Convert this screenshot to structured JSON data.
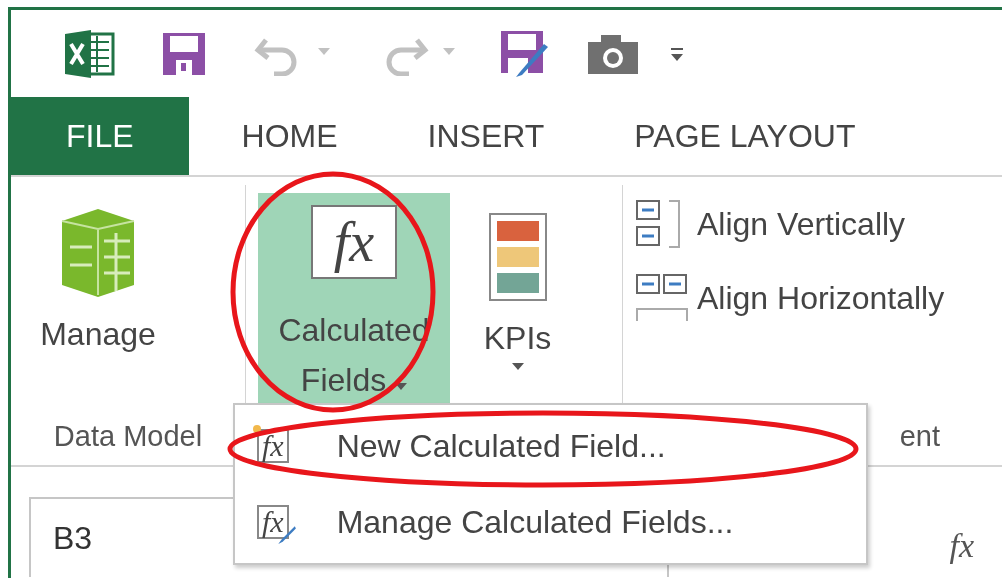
{
  "quick_access": [
    {
      "kind": "excel",
      "disabled": false
    },
    {
      "kind": "save",
      "disabled": false
    },
    {
      "kind": "undo",
      "disabled": true
    },
    {
      "kind": "redo",
      "disabled": true
    },
    {
      "kind": "save-edit",
      "disabled": false
    },
    {
      "kind": "camera",
      "disabled": false
    },
    {
      "kind": "customize",
      "disabled": false
    }
  ],
  "tabs": [
    {
      "label": "FILE",
      "kind": "file"
    },
    {
      "label": "HOME",
      "kind": "tab"
    },
    {
      "label": "INSERT",
      "kind": "tab"
    },
    {
      "label": "PAGE LAYOUT",
      "kind": "tab"
    }
  ],
  "ribbon": {
    "groups": [
      {
        "label": "Data Model",
        "buttons": [
          {
            "kind": "manage",
            "label": "Manage",
            "dropdown": false,
            "pressed": false
          }
        ]
      },
      {
        "buttons": [
          {
            "kind": "calc",
            "label": "Calculated Fields",
            "icon_text": "fx",
            "dropdown": true,
            "pressed": true
          },
          {
            "kind": "kpi",
            "label": "KPIs",
            "dropdown": true,
            "pressed": false
          }
        ]
      },
      {
        "label": "ent",
        "small_buttons": [
          {
            "kind": "vertical",
            "label": "Align Vertically"
          },
          {
            "kind": "horizontal",
            "label": "Align Horizontally"
          }
        ]
      }
    ]
  },
  "dropdown_menu": {
    "items": [
      {
        "kind": "new",
        "label": "New Calculated Field...",
        "icon_text": "fx"
      },
      {
        "kind": "manage",
        "label": "Manage Calculated Fields...",
        "icon_text": "fx"
      }
    ]
  },
  "formula_bar": {
    "name_box": "B3",
    "fx": "fx"
  },
  "annotations": [
    {
      "kind": "ellipse"
    },
    {
      "kind": "ellipse"
    }
  ]
}
